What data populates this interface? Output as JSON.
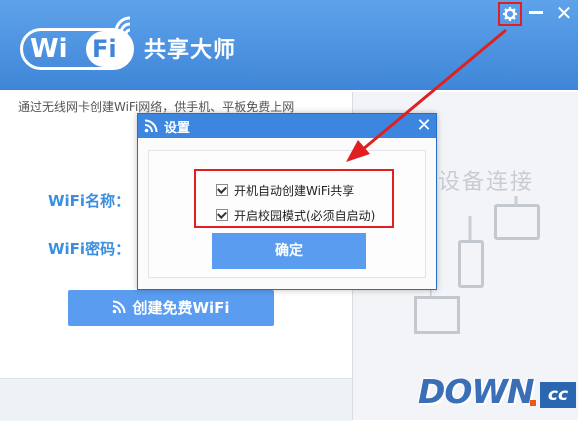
{
  "app": {
    "logo_wi": "Wi",
    "logo_fi": "Fi",
    "title": "共享大师"
  },
  "subtitle": "通过无线网卡创建WiFi网络，供手机、平板免费上网",
  "form": {
    "wifi_name_label": "WiFi名称：",
    "wifi_password_label": "WiFi密码：",
    "create_button": "创建免费WiFi"
  },
  "right_panel": {
    "device_text": "设备连接"
  },
  "settings_dialog": {
    "title": "设置",
    "options": [
      {
        "label": "开机自动创建WiFi共享",
        "checked": true
      },
      {
        "label": "开启校园模式(必须自启动)",
        "checked": true
      }
    ],
    "ok_button": "确定"
  },
  "watermark": {
    "down": "DOWN",
    "cc": "cc"
  },
  "colors": {
    "header_blue": "#4a92e0",
    "accent_blue": "#5a9cf0",
    "highlight_red": "#e02020"
  },
  "icons": {
    "settings": "gear-icon",
    "minimize": "minimize-icon",
    "close": "close-icon",
    "wifi": "wifi-icon"
  }
}
